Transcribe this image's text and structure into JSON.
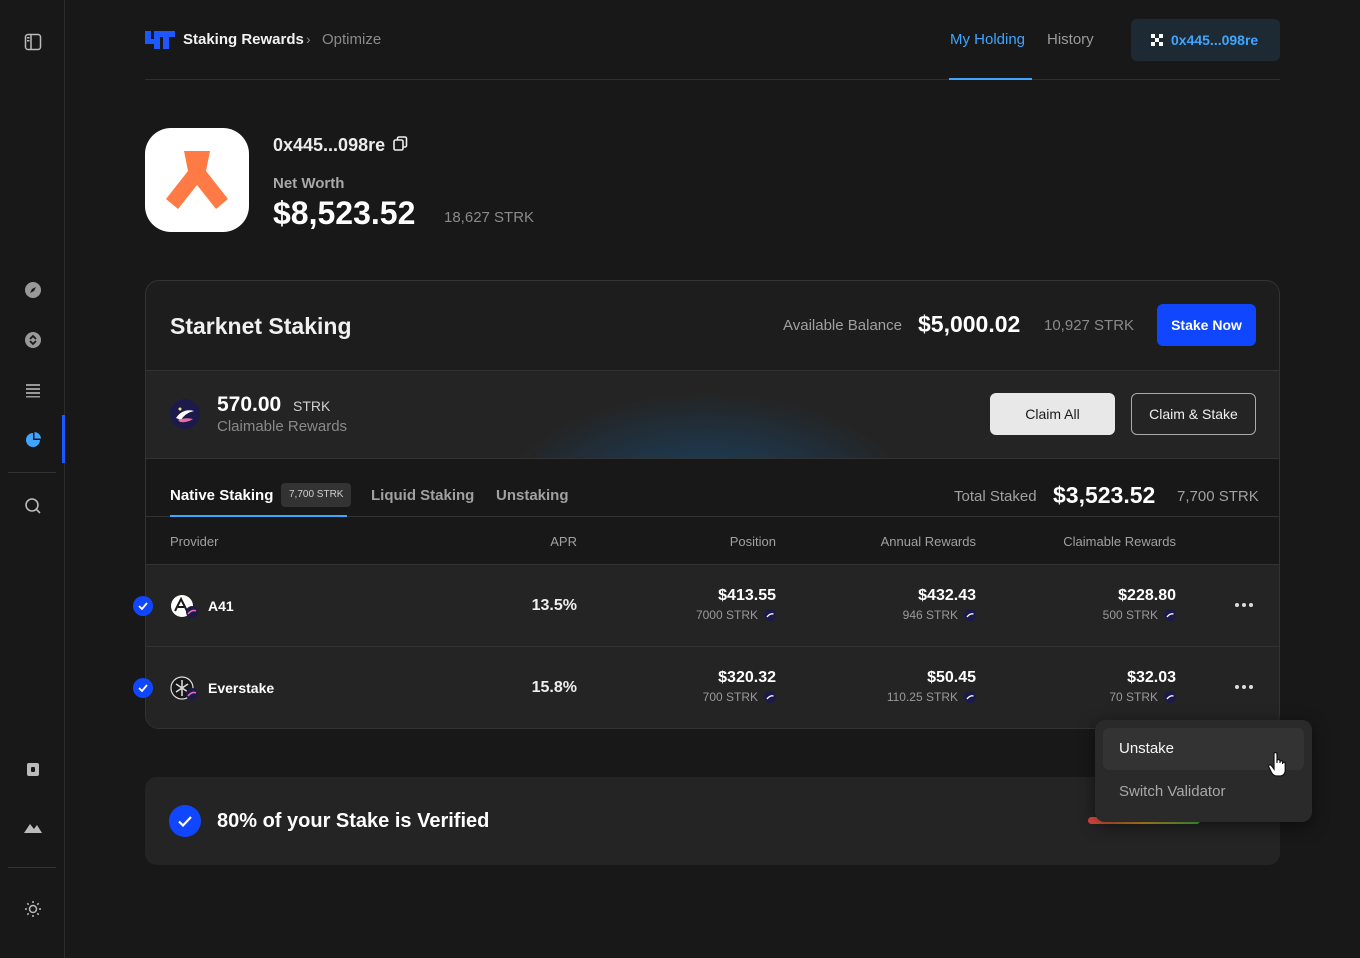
{
  "colors": {
    "accent_blue": "#3fa5ff",
    "primary_button": "#1146ff",
    "background": "#181818",
    "surface": "#242424"
  },
  "sidebar": {
    "icons": [
      "panel-toggle-icon",
      "compass-icon",
      "swap-icon",
      "list-icon",
      "pie-chart-icon",
      "search-icon",
      "lock-icon",
      "mountain-icon",
      "sun-icon"
    ]
  },
  "header": {
    "brand": "Staking Rewards",
    "breadcrumb_sep": "›",
    "breadcrumb": "Optimize",
    "tabs": [
      {
        "label": "My Holding",
        "active": true
      },
      {
        "label": "History",
        "active": false
      }
    ],
    "wallet": "0x445...098re"
  },
  "profile": {
    "address": "0x445...098re",
    "net_worth_label": "Net Worth",
    "net_worth_value": "$8,523.52",
    "net_worth_sub": "18,627 STRK"
  },
  "staking": {
    "title": "Starknet Staking",
    "available_label": "Available Balance",
    "available_value": "$5,000.02",
    "available_sub": "10,927 STRK",
    "stake_now": "Stake Now",
    "claimable_amount": "570.00",
    "claimable_unit": "STRK",
    "claimable_label": "Claimable Rewards",
    "claim_all": "Claim All",
    "claim_stake": "Claim & Stake",
    "tabs": [
      {
        "label": "Native Staking",
        "badge": "7,700 STRK",
        "active": true
      },
      {
        "label": "Liquid Staking",
        "active": false
      },
      {
        "label": "Unstaking",
        "active": false
      }
    ],
    "total_staked_label": "Total Staked",
    "total_staked_value": "$3,523.52",
    "total_staked_sub": "7,700 STRK",
    "columns": [
      "Provider",
      "APR",
      "Position",
      "Annual Rewards",
      "Claimable Rewards"
    ],
    "rows": [
      {
        "provider": "A41",
        "apr": "13.5%",
        "position": "$413.55",
        "position_sub": "7000 STRK",
        "annual": "$432.43",
        "annual_sub": "946 STRK",
        "claimable": "$228.80",
        "claimable_sub": "500 STRK",
        "checked": true
      },
      {
        "provider": "Everstake",
        "apr": "15.8%",
        "position": "$320.32",
        "position_sub": "700 STRK",
        "annual": "$50.45",
        "annual_sub": "110.25 STRK",
        "claimable": "$32.03",
        "claimable_sub": "70 STRK",
        "checked": true
      }
    ]
  },
  "verified": {
    "text": "80% of your Stake is Verified",
    "progress": 0.8
  },
  "menu": {
    "items": [
      "Unstake",
      "Switch Validator"
    ]
  }
}
